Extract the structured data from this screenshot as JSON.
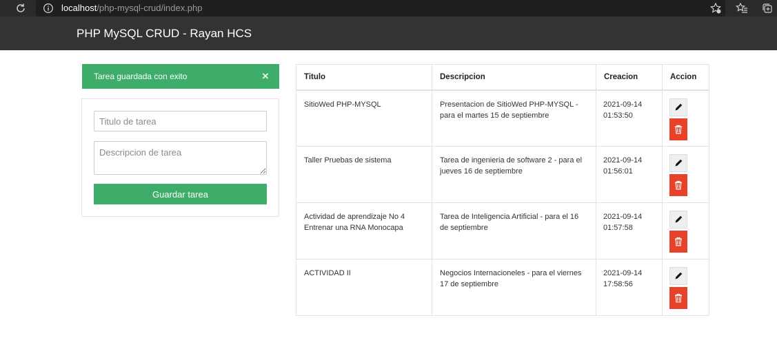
{
  "browser": {
    "url_host": "localhost",
    "url_path": "/php-mysql-crud/index.php"
  },
  "navbar": {
    "brand": "PHP MySQL CRUD - Rayan HCS"
  },
  "alert": {
    "message": "Tarea guardada con exito",
    "close_label": "×",
    "color": "#3fad6a"
  },
  "form": {
    "title_placeholder": "Titulo de tarea",
    "title_value": "",
    "description_placeholder": "Descripcion de tarea",
    "description_value": "",
    "submit_label": "Guardar tarea"
  },
  "table": {
    "headers": {
      "title": "Titulo",
      "description": "Descripcion",
      "created": "Creacion",
      "actions": "Accion"
    },
    "rows": [
      {
        "title": "SitioWed PHP-MYSQL",
        "description": "Presentacion de SitioWed PHP-MYSQL - para el martes 15 de septiembre",
        "created_date": "2021-09-14",
        "created_time": "01:53:50"
      },
      {
        "title": "Taller Pruebas de sistema",
        "description": "Tarea de ingenieria de software 2 - para el jueves 16 de septiembre",
        "created_date": "2021-09-14",
        "created_time": "01:56:01"
      },
      {
        "title": "Actividad de aprendizaje No 4 Entrenar una RNA Monocapa",
        "description": "Tarea de Inteligencia Artificial - para el 16 de septiembre",
        "created_date": "2021-09-14",
        "created_time": "01:57:58"
      },
      {
        "title": "ACTIVIDAD II",
        "description": "Negocios Internacioneles - para el viernes 17 de septiembre",
        "created_date": "2021-09-14",
        "created_time": "17:58:56"
      }
    ],
    "edit_icon": "pen-icon",
    "delete_icon": "trash-icon",
    "delete_color": "#e8432a"
  },
  "colors": {
    "navbar_bg": "#333333",
    "success": "#3fad6a",
    "danger": "#e8432a"
  }
}
